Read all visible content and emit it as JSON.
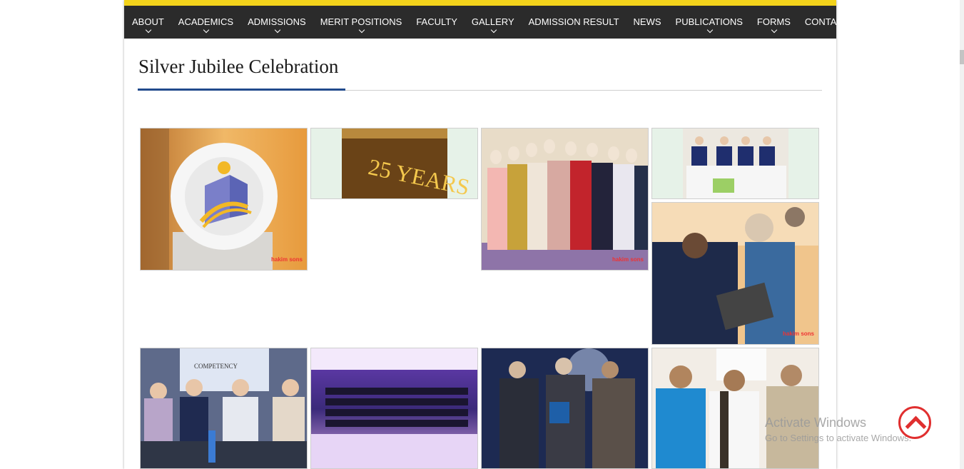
{
  "nav": {
    "items": [
      {
        "label": "ABOUT",
        "dropdown": true
      },
      {
        "label": "ACADEMICS",
        "dropdown": true
      },
      {
        "label": "ADMISSIONS",
        "dropdown": true
      },
      {
        "label": "MERIT POSITIONS",
        "dropdown": true
      },
      {
        "label": "FACULTY",
        "dropdown": false
      },
      {
        "label": "GALLERY",
        "dropdown": true
      },
      {
        "label": "ADMISSION RESULT",
        "dropdown": false
      },
      {
        "label": "NEWS",
        "dropdown": false
      },
      {
        "label": "PUBLICATIONS",
        "dropdown": true
      },
      {
        "label": "FORMS",
        "dropdown": true
      },
      {
        "label": "CONTACT",
        "dropdown": false
      }
    ]
  },
  "page": {
    "title": "Silver Jubilee Celebration"
  },
  "gallery": {
    "photos": [
      {
        "name": "photo-logo-sculpture",
        "watermark": "hakim sons"
      },
      {
        "name": "photo-25-years-sign",
        "sign_text": "25 YEARS"
      },
      {
        "name": "photo-student-group",
        "watermark": "hakim sons"
      },
      {
        "name": "photo-panel-stage"
      },
      {
        "name": "photo-laptop-demo",
        "watermark": "hakim sons"
      },
      {
        "name": "photo-conference-table",
        "banner": "COMPETENCY"
      },
      {
        "name": "photo-auditorium"
      },
      {
        "name": "photo-award-handshake"
      },
      {
        "name": "photo-three-men"
      }
    ]
  },
  "overlay": {
    "activate_title": "Activate Windows",
    "activate_sub": "Go to Settings to activate Windows."
  },
  "colors": {
    "accent_yellow": "#f3d31b",
    "nav_bg": "#2b2b2b",
    "title_rule": "#214a8c",
    "scroll_button": "#e02f2f"
  }
}
